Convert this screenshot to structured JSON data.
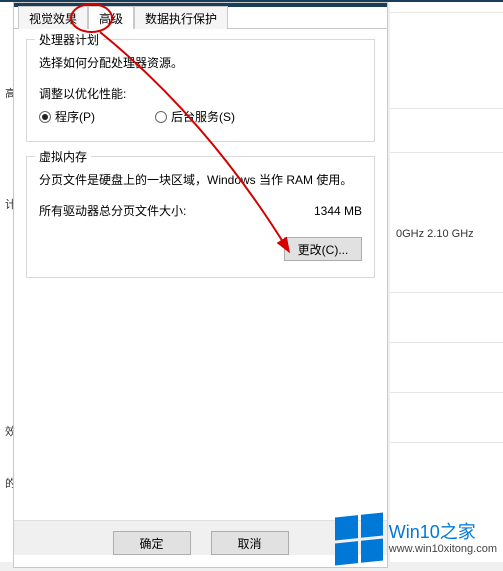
{
  "tabs": {
    "visual": "视觉效果",
    "advanced": "高级",
    "dep": "数据执行保护"
  },
  "cpu_group": {
    "legend": "处理器计划",
    "desc": "选择如何分配处理器资源。",
    "adjust_label": "调整以优化性能:",
    "radio_programs": "程序(P)",
    "radio_services": "后台服务(S)"
  },
  "vm_group": {
    "legend": "虚拟内存",
    "desc": "分页文件是硬盘上的一块区域，Windows 当作 RAM 使用。",
    "total_label": "所有驱动器总分页文件大小:",
    "total_value": "1344 MB",
    "change_btn": "更改(C)..."
  },
  "buttons": {
    "ok": "确定",
    "cancel": "取消"
  },
  "bg": {
    "cpu_speed": "0GHz   2.10 GHz",
    "left_a": "高级",
    "left_b": "计",
    "left_c": "效障",
    "left_d": "的桌"
  },
  "watermark": {
    "title": "Win10之家",
    "url": "www.win10xitong.com"
  }
}
